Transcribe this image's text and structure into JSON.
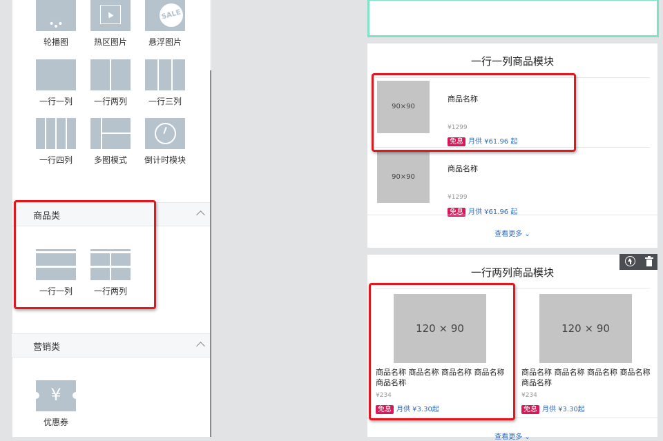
{
  "panel": {
    "basic_tiles": [
      {
        "label": "轮播图",
        "icon": "carousel-icon"
      },
      {
        "label": "热区图片",
        "icon": "hotspot-icon"
      },
      {
        "label": "悬浮图片",
        "icon": "sale-float-icon"
      },
      {
        "label": "一行一列",
        "icon": "one-column-icon"
      },
      {
        "label": "一行两列",
        "icon": "two-column-icon"
      },
      {
        "label": "一行三列",
        "icon": "three-column-icon"
      },
      {
        "label": "一行四列",
        "icon": "four-column-icon"
      },
      {
        "label": "多图模式",
        "icon": "multi-image-icon"
      },
      {
        "label": "倒计时模块",
        "icon": "clock-icon"
      }
    ],
    "sale_badge_text": "SALE",
    "goods_section": {
      "title": "商品类",
      "tiles": [
        {
          "label": "一行一列",
          "icon": "goods-one-column-icon"
        },
        {
          "label": "一行两列",
          "icon": "goods-two-column-icon"
        }
      ]
    },
    "marketing_section": {
      "title": "营销类",
      "tiles": [
        {
          "label": "优惠券",
          "icon": "coupon-icon",
          "glyph": "¥"
        }
      ]
    }
  },
  "preview": {
    "module1": {
      "title": "一行一列商品模块",
      "items": [
        {
          "image": "90×90",
          "name": "商品名称",
          "price": "¥1299",
          "badge": "免息",
          "installment": "月供 ¥61.96 起"
        },
        {
          "image": "90×90",
          "name": "商品名称",
          "price": "¥1299",
          "badge": "免息",
          "installment": "月供 ¥61.96 起"
        }
      ],
      "more": "查看更多"
    },
    "module2": {
      "title": "一行两列商品模块",
      "items": [
        {
          "image": "120 × 90",
          "name": "商品名称 商品名称 商品名称 商品名称 商品名称",
          "price": "¥234",
          "badge": "免息",
          "installment": "月供 ¥3.30起"
        },
        {
          "image": "120 × 90",
          "name": "商品名称 商品名称 商品名称 商品名称 商品名称",
          "price": "¥234",
          "badge": "免息",
          "installment": "月供 ¥3.30起"
        }
      ],
      "more": "查看更多"
    }
  },
  "colors": {
    "highlight": "#e2161d",
    "badge": "#d8185a",
    "link": "#2f6ebd",
    "selected_border": "#7de3c4"
  }
}
